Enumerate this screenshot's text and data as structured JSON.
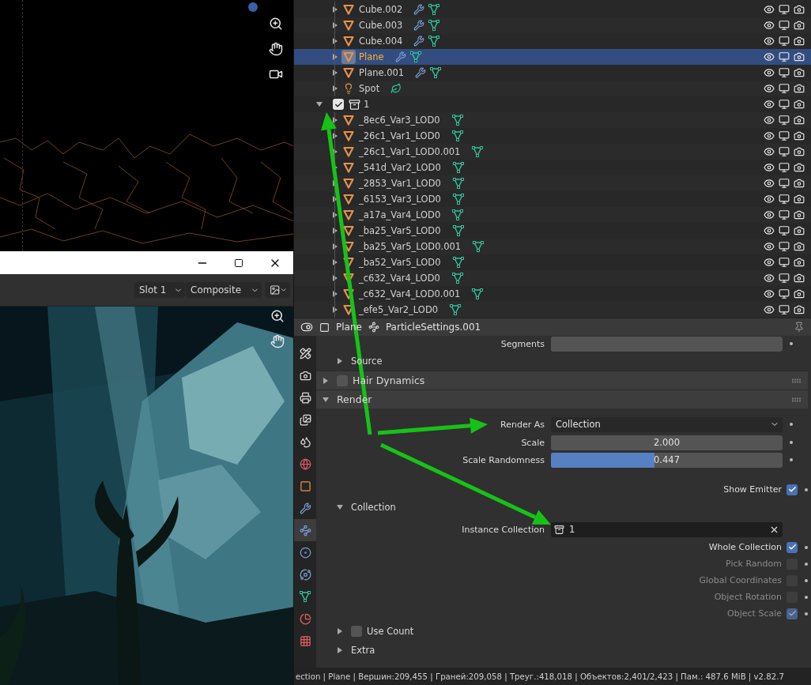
{
  "image_editor": {
    "slot": "Slot 1",
    "pass": "Composite"
  },
  "outliner": {
    "items": [
      {
        "kind": "mesh",
        "name": "Cube.002",
        "modifier": true,
        "selected": false
      },
      {
        "kind": "mesh",
        "name": "Cube.003",
        "modifier": true,
        "selected": false
      },
      {
        "kind": "mesh",
        "name": "Cube.004",
        "modifier": true,
        "selected": false
      },
      {
        "kind": "mesh",
        "name": "Plane",
        "modifier": true,
        "selected": true
      },
      {
        "kind": "mesh",
        "name": "Plane.001",
        "modifier": true,
        "selected": false
      },
      {
        "kind": "light",
        "name": "Spot",
        "modifier": false,
        "selected": false
      },
      {
        "kind": "collection",
        "name": "1",
        "checked": true,
        "expanded": true,
        "selected": false,
        "children": [
          {
            "kind": "mesh",
            "name": "_8ec6_Var3_LOD0",
            "modifier": false,
            "selected": false
          },
          {
            "kind": "mesh",
            "name": "_26c1_Var1_LOD0",
            "modifier": false,
            "selected": false
          },
          {
            "kind": "mesh",
            "name": "_26c1_Var1_LOD0.001",
            "modifier": false,
            "selected": false
          },
          {
            "kind": "mesh",
            "name": "_541d_Var2_LOD0",
            "modifier": false,
            "selected": false
          },
          {
            "kind": "mesh",
            "name": "_2853_Var1_LOD0",
            "modifier": false,
            "selected": false
          },
          {
            "kind": "mesh",
            "name": "_6153_Var3_LOD0",
            "modifier": false,
            "selected": false
          },
          {
            "kind": "mesh",
            "name": "_a17a_Var4_LOD0",
            "modifier": false,
            "selected": false
          },
          {
            "kind": "mesh",
            "name": "_ba25_Var5_LOD0",
            "modifier": false,
            "selected": false
          },
          {
            "kind": "mesh",
            "name": "_ba25_Var5_LOD0.001",
            "modifier": false,
            "selected": false
          },
          {
            "kind": "mesh",
            "name": "_ba52_Var5_LOD0",
            "modifier": false,
            "selected": false
          },
          {
            "kind": "mesh",
            "name": "_c632_Var4_LOD0",
            "modifier": false,
            "selected": false
          },
          {
            "kind": "mesh",
            "name": "_c632_Var4_LOD0.001",
            "modifier": false,
            "selected": false
          },
          {
            "kind": "mesh",
            "name": "_efe5_Var2_LOD0",
            "modifier": false,
            "selected": false
          }
        ]
      }
    ]
  },
  "properties": {
    "breadcrumbs": [
      "Plane",
      "ParticleSettings.001"
    ],
    "tabs": [
      {
        "kind": "tool",
        "selected": false
      },
      {
        "kind": "render",
        "selected": false
      },
      {
        "kind": "output",
        "selected": false
      },
      {
        "kind": "view_layer",
        "selected": false
      },
      {
        "kind": "scene",
        "selected": false
      },
      {
        "kind": "world",
        "selected": false
      },
      {
        "kind": "object",
        "selected": false
      },
      {
        "kind": "modifier",
        "selected": false
      },
      {
        "kind": "particles",
        "selected": true
      },
      {
        "kind": "physics",
        "selected": false
      },
      {
        "kind": "constraints",
        "selected": false
      },
      {
        "kind": "data",
        "selected": false
      },
      {
        "kind": "material",
        "selected": false
      },
      {
        "kind": "texture",
        "selected": false
      }
    ],
    "rows": [
      {
        "kind": "field",
        "label": "Segments"
      },
      {
        "kind": "subpanel",
        "label": "Source",
        "expanded": false
      },
      {
        "kind": "panel",
        "label": "Hair Dynamics",
        "expanded": false,
        "checked": false
      },
      {
        "kind": "panel",
        "label": "Render",
        "expanded": true
      },
      {
        "kind": "dropdown",
        "label": "Render As",
        "value": "Collection"
      },
      {
        "kind": "number",
        "label": "Scale",
        "value": "2.000"
      },
      {
        "kind": "slider",
        "label": "Scale Randomness",
        "value": "0.447",
        "level": 0.447
      },
      {
        "kind": "checkbox",
        "label": "Show Emitter",
        "checked": true,
        "disabled": false
      },
      {
        "kind": "subpanel",
        "label": "Collection",
        "expanded": true
      },
      {
        "kind": "collection_field",
        "label": "Instance Collection",
        "value": "1"
      },
      {
        "kind": "checkbox",
        "label": "Whole Collection",
        "checked": true,
        "disabled": false
      },
      {
        "kind": "checkbox",
        "label": "Pick Random",
        "checked": false,
        "disabled": true
      },
      {
        "kind": "checkbox",
        "label": "Global Coordinates",
        "checked": false,
        "disabled": true
      },
      {
        "kind": "checkbox",
        "label": "Object Rotation",
        "checked": false,
        "disabled": true
      },
      {
        "kind": "checkbox",
        "label": "Object Scale",
        "checked": true,
        "disabled": true
      },
      {
        "kind": "subpanel",
        "label": "Use Count",
        "expanded": false,
        "checked": false
      },
      {
        "kind": "subpanel",
        "label": "Extra",
        "expanded": false
      }
    ]
  },
  "status_bar": "ection | Plane | Вершин:209,455 | Граней:209,058 | Треуг.:418,018 | Объектов:2,401/2,423 | Пам.: 487.6 MiB | v2.82.7"
}
